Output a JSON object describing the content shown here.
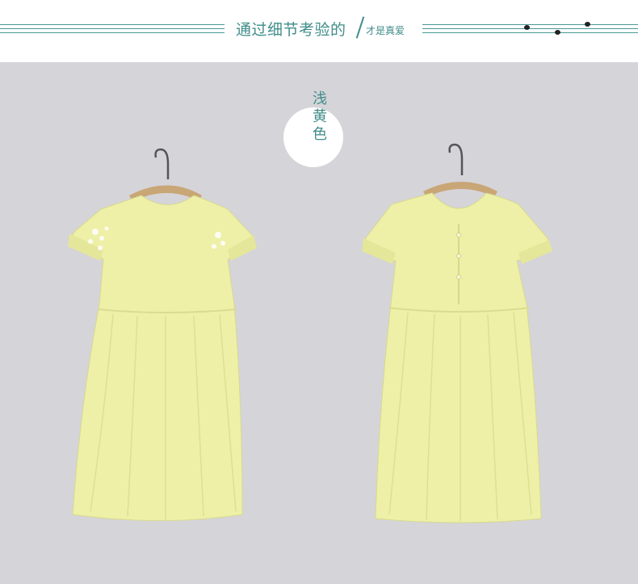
{
  "header": {
    "title": "通过细节考验的",
    "subtitle": "才是真爱"
  },
  "product": {
    "color_name": "浅黄色",
    "views": [
      "front",
      "back"
    ],
    "dress_color": "#eef0a8",
    "background_color": "#d5d4d9",
    "accent_color": "#3f8d89"
  }
}
